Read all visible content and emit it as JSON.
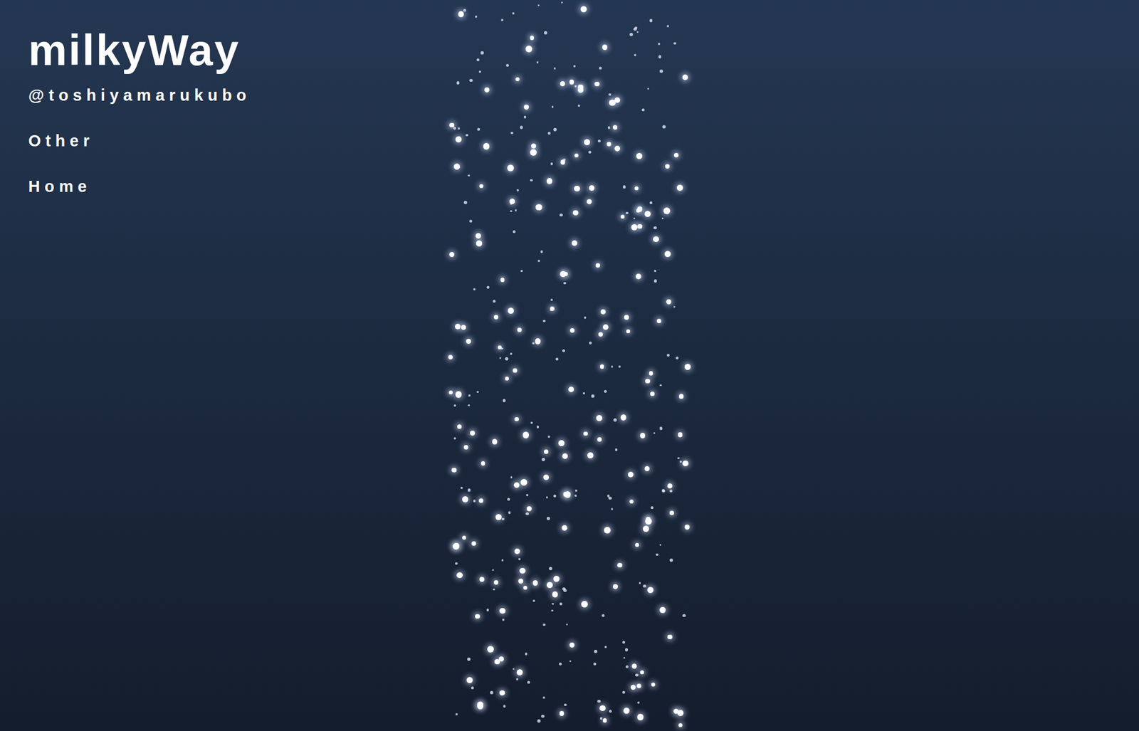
{
  "site": {
    "title": "milkyWay"
  },
  "nav": [
    {
      "label": "@toshiyamarukubo"
    },
    {
      "label": "Other"
    },
    {
      "label": "Home"
    }
  ]
}
